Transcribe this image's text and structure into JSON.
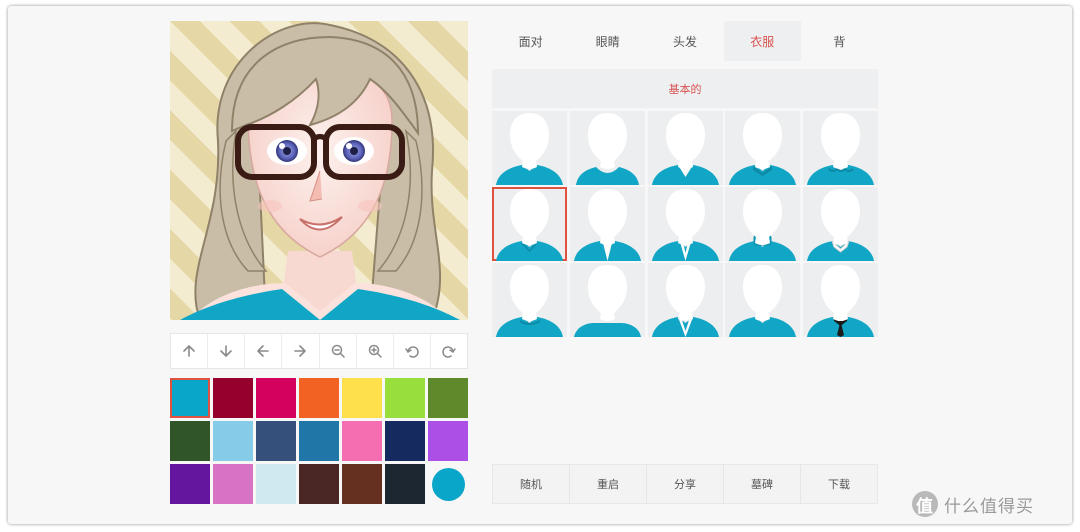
{
  "avatar": {
    "name": "avatar-preview",
    "hair_color": "#c9bda8",
    "clothes_color": "#12a6c6",
    "skin_color": "#fbe2dc",
    "background_stripe_colors": [
      "#f4ecd0",
      "#e6d7a6"
    ]
  },
  "controls": [
    {
      "name": "move-up-button",
      "icon": "arrow-up-icon",
      "glyph": "up"
    },
    {
      "name": "move-down-button",
      "icon": "arrow-down-icon",
      "glyph": "down"
    },
    {
      "name": "move-left-button",
      "icon": "arrow-left-icon",
      "glyph": "left"
    },
    {
      "name": "move-right-button",
      "icon": "arrow-right-icon",
      "glyph": "right"
    },
    {
      "name": "zoom-out-button",
      "icon": "zoom-out-icon",
      "glyph": "zoomout"
    },
    {
      "name": "zoom-in-button",
      "icon": "zoom-in-icon",
      "glyph": "zoomin"
    },
    {
      "name": "undo-button",
      "icon": "undo-icon",
      "glyph": "undo"
    },
    {
      "name": "redo-button",
      "icon": "redo-icon",
      "glyph": "redo"
    }
  ],
  "palette": {
    "selected_index": 0,
    "colors": [
      "#0aa6c9",
      "#95002c",
      "#d4015f",
      "#f26223",
      "#fee04c",
      "#98de3c",
      "#5e8a2c",
      "#2f5528",
      "#86cce8",
      "#36507c",
      "#2176a8",
      "#f66eb2",
      "#152a5f",
      "#ac4fe6",
      "#64179e",
      "#d872c5",
      "#cfe9f0",
      "#4a2624",
      "#653020",
      "#1c2731",
      "#0aa6c9"
    ],
    "last_is_circle": true
  },
  "tabs": {
    "active_index": 3,
    "items": [
      {
        "name": "tab-face",
        "label": "面对"
      },
      {
        "name": "tab-eyes",
        "label": "眼睛"
      },
      {
        "name": "tab-hair",
        "label": "头发"
      },
      {
        "name": "tab-clothes",
        "label": "衣服"
      },
      {
        "name": "tab-background",
        "label": "背"
      }
    ]
  },
  "subheader": {
    "label": "基本的"
  },
  "clothes_grid": {
    "selected_index": 5,
    "item_color": "#12a6c6",
    "items": [
      {
        "style": "crew"
      },
      {
        "style": "scoop"
      },
      {
        "style": "vneck"
      },
      {
        "style": "collar"
      },
      {
        "style": "ruffle"
      },
      {
        "style": "bow"
      },
      {
        "style": "cardigan"
      },
      {
        "style": "blazer"
      },
      {
        "style": "turtleneck"
      },
      {
        "style": "shirt"
      },
      {
        "style": "wrap"
      },
      {
        "style": "boat"
      },
      {
        "style": "jacket"
      },
      {
        "style": "crew2"
      },
      {
        "style": "tie"
      }
    ]
  },
  "actions": [
    {
      "name": "random-button",
      "label": "随机"
    },
    {
      "name": "restart-button",
      "label": "重启"
    },
    {
      "name": "share-button",
      "label": "分享"
    },
    {
      "name": "tombstone-button",
      "label": "墓碑"
    },
    {
      "name": "download-button",
      "label": "下载"
    }
  ],
  "watermark": {
    "logo": "值",
    "text": "什么值得买"
  }
}
